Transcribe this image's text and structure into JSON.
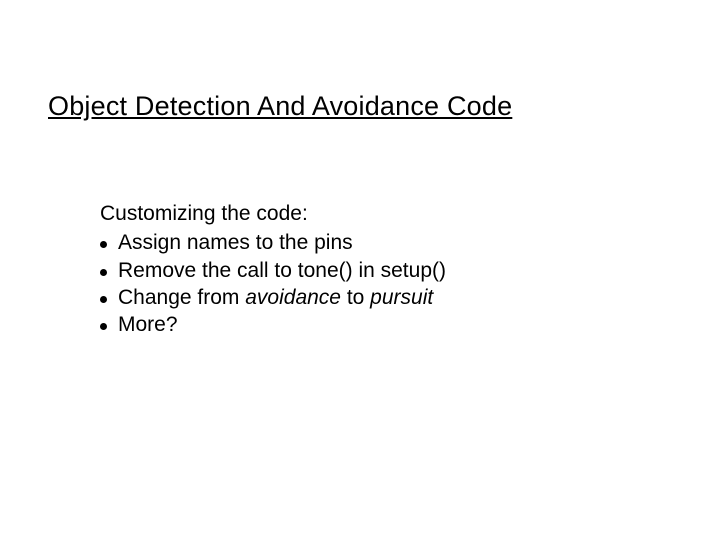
{
  "slide": {
    "title": "Object Detection And Avoidance Code",
    "lead": "Customizing the code:",
    "items": [
      {
        "pre": "Assign names to the pins",
        "em1": "",
        "mid": "",
        "em2": "",
        "post": ""
      },
      {
        "pre": "Remove the call to tone() in setup()",
        "em1": "",
        "mid": "",
        "em2": "",
        "post": ""
      },
      {
        "pre": "Change from ",
        "em1": "avoidance",
        "mid": " to ",
        "em2": "pursuit",
        "post": ""
      },
      {
        "pre": "More?",
        "em1": "",
        "mid": "",
        "em2": "",
        "post": ""
      }
    ]
  }
}
